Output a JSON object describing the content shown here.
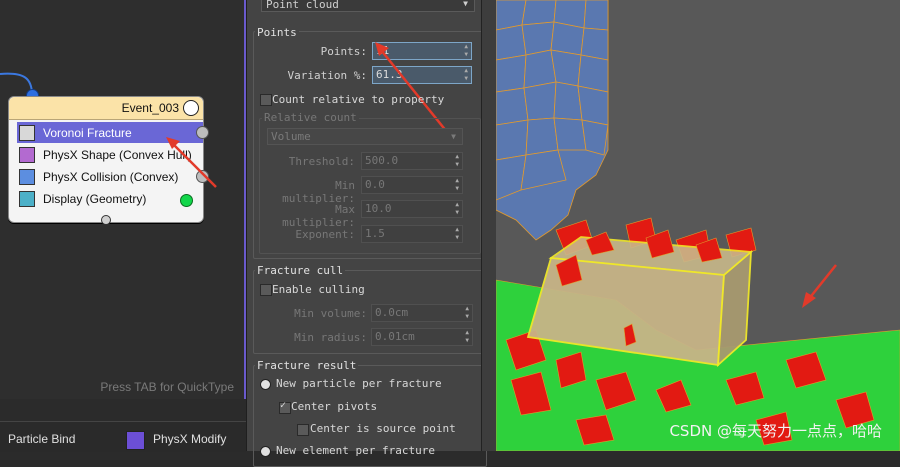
{
  "node_editor": {
    "event_name": "Event_003",
    "operators": [
      {
        "label": "Voronoi Fracture",
        "selected": true,
        "icon": "voronoi-icon"
      },
      {
        "label": "PhysX Shape (Convex Hull)",
        "selected": false,
        "icon": "physx-shape-icon"
      },
      {
        "label": "PhysX Collision (Convex)",
        "selected": false,
        "icon": "physx-collision-icon"
      },
      {
        "label": "Display (Geometry)",
        "selected": false,
        "icon": "display-icon"
      }
    ],
    "hint": "Press TAB for QuickType"
  },
  "bottom_bar": {
    "item1": "Particle Bind",
    "item2": "PhysX Modify"
  },
  "props": {
    "source_dropdown": "Point cloud",
    "points_group": {
      "title": "Points",
      "points_label": "Points:",
      "points_value": "11",
      "variation_label": "Variation %:",
      "variation_value": "61.3",
      "count_relative_label": "Count relative to property",
      "relative_count_title": "Relative count",
      "relative_dropdown": "Volume",
      "threshold_label": "Threshold:",
      "threshold_value": "500.0",
      "min_mult_label": "Min multiplier:",
      "min_mult_value": "0.0",
      "max_mult_label": "Max multiplier:",
      "max_mult_value": "10.0",
      "exponent_label": "Exponent:",
      "exponent_value": "1.5"
    },
    "cull_group": {
      "title": "Fracture cull",
      "enable_label": "Enable culling",
      "min_volume_label": "Min volume:",
      "min_volume_value": "0.0cm",
      "min_radius_label": "Min radius:",
      "min_radius_value": "0.01cm"
    },
    "result_group": {
      "title": "Fracture result",
      "opt1": "New particle per fracture",
      "opt2": "Center pivots",
      "opt3": "Center is source point",
      "opt4": "New element per fracture"
    }
  },
  "viewport": {
    "watermark": "CSDN @每天努力一点点，哈哈"
  },
  "colors": {
    "selection": "#6a67d6",
    "event_header": "#fbe3a8",
    "annotation_arrow": "#e23a2a",
    "fragment_green": "#2ed13c",
    "fragment_red": "#e21a12",
    "box_yellow": "#e8e030"
  }
}
